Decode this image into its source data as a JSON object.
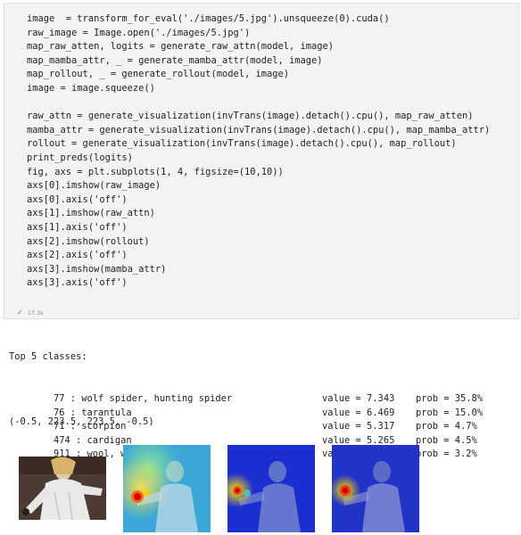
{
  "cell": {
    "code_lines": [
      "image  = transform_for_eval('./images/5.jpg').unsqueeze(0).cuda()",
      "raw_image = Image.open('./images/5.jpg')",
      "map_raw_atten, logits = generate_raw_attn(model, image)",
      "map_mamba_attr, _ = generate_mamba_attr(model, image)",
      "map_rollout, _ = generate_rollout(model, image)",
      "image = image.squeeze()",
      "",
      "raw_attn = generate_visualization(invTrans(image).detach().cpu(), map_raw_atten)",
      "mamba_attr = generate_visualization(invTrans(image).detach().cpu(), map_mamba_attr)",
      "rollout = generate_visualization(invTrans(image).detach().cpu(), map_rollout)",
      "print_preds(logits)",
      "fig, axs = plt.subplots(1, 4, figsize=(10,10))",
      "axs[0].imshow(raw_image)",
      "axs[0].axis('off')",
      "axs[1].imshow(raw_attn)",
      "axs[1].axis('off')",
      "axs[2].imshow(rollout)",
      "axs[2].axis('off')",
      "axs[3].imshow(mamba_attr)",
      "axs[3].axis('off')"
    ],
    "exec_time": "17.3s",
    "status_icon": "check-icon"
  },
  "output": {
    "header": "Top 5 classes:",
    "predictions": [
      {
        "label": "77 : wolf spider, hunting spider",
        "value": "value = 7.343",
        "prob": "prob = 35.8%"
      },
      {
        "label": "76 : tarantula",
        "value": "value = 6.469",
        "prob": "prob = 15.0%"
      },
      {
        "label": "71 : scorpion",
        "value": "value = 5.317",
        "prob": "prob = 4.7%"
      },
      {
        "label": "474 : cardigan",
        "value": "value = 5.265",
        "prob": "prob = 4.5%"
      },
      {
        "label": "911 : wool, woolen, woollen",
        "value": "value = 4.921",
        "prob": "prob = 3.2%"
      }
    ],
    "extent": "(-0.5, 223.5, 223.5, -0.5)"
  },
  "colors": {
    "cell_bg": "#f3f3f3",
    "keyword": "#1f1f1f",
    "string": "#a31515",
    "number": "#098658",
    "heat_cold": "#1a2fd0",
    "heat_hot": "#ff2a00"
  }
}
